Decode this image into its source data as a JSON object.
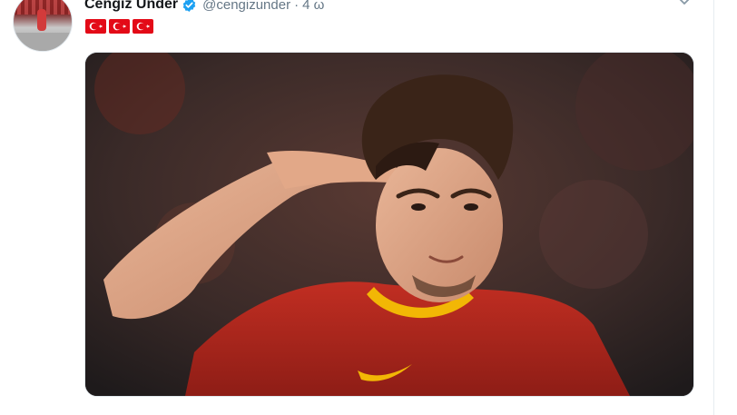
{
  "tweet": {
    "author_name": "Cengiz Ünder",
    "handle": "@cengizunder",
    "separator": "·",
    "time": "4 ω",
    "flags": [
      "turkey-flag",
      "turkey-flag",
      "turkey-flag"
    ],
    "media": {
      "description_icon": "photo"
    }
  },
  "colors": {
    "verified": "#1da1f2",
    "flag_red": "#e30a17",
    "jersey": "#b8281f",
    "text_primary": "#14171a",
    "text_secondary": "#657786"
  }
}
